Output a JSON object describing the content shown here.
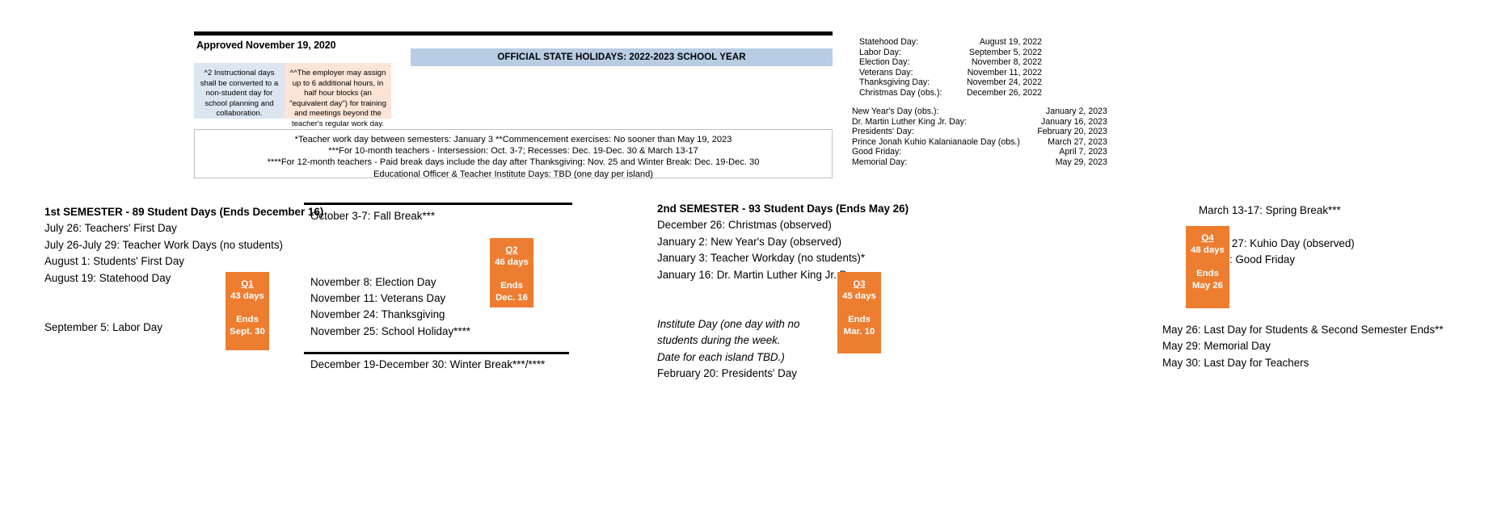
{
  "header": {
    "approved_text": "Approved November 19, 2020",
    "banner_title": "OFFICIAL STATE HOLIDAYS:  2022-2023 SCHOOL YEAR",
    "banner_color": "#b8cce4"
  },
  "notes": {
    "instructional_days": "^2 Instructional days shall be converted to a non-student day for school planning and collaboration.",
    "instructional_days_color": "#dce6f1",
    "employer_hours": "^^The employer may assign up to 6 additional hours, in half hour blocks (an \"equivalent day\") for training and meetings beyond the teacher's regular work day.",
    "employer_hours_color": "#fce4d6"
  },
  "footnotes": [
    "*Teacher work day between semesters: January 3   **Commencement exercises: No sooner than May 19, 2023",
    "***For 10-month teachers - Intersession: Oct. 3-7; Recesses: Dec. 19-Dec. 30 & March 13-17",
    "****For 12-month teachers - Paid break days include the day after Thanksgiving: Nov. 25 and Winter Break: Dec. 19-Dec. 30",
    "Educational Officer & Teacher Institute Days: TBD (one day per island)"
  ],
  "holidays_2022": [
    {
      "name": "Statehood Day:",
      "date": "August 19, 2022"
    },
    {
      "name": "Labor Day:",
      "date": "September 5, 2022"
    },
    {
      "name": "Election Day:",
      "date": "November 8, 2022"
    },
    {
      "name": "Veterans Day:",
      "date": "November 11, 2022"
    },
    {
      "name": "Thanksgiving Day:",
      "date": "November 24, 2022"
    },
    {
      "name": "Christmas Day (obs.):",
      "date": "December 26, 2022"
    }
  ],
  "holidays_2023": [
    {
      "name": "New Year's Day (obs.):",
      "date": "January 2, 2023"
    },
    {
      "name": "Dr. Martin Luther King Jr. Day:",
      "date": "January 16, 2023"
    },
    {
      "name": "Presidents' Day:",
      "date": "February 20, 2023"
    },
    {
      "name": "Prince Jonah Kuhio Kalanianaole Day (obs.)",
      "date": "March 27, 2023"
    },
    {
      "name": "Good Friday:",
      "date": "April 7, 2023"
    },
    {
      "name": "Memorial Day:",
      "date": "May 29, 2023"
    }
  ],
  "semester1": {
    "title": "1st SEMESTER - 89 Student Days (Ends December 16)",
    "lines": [
      "July 26: Teachers' First Day",
      "July 26-July 29: Teacher Work Days (no students)",
      "August 1: Students' First Day",
      "August 19: Statehood Day",
      "",
      "September 5: Labor Day"
    ]
  },
  "fall_column": {
    "lines": [
      "October 3-7: Fall Break***",
      "",
      "",
      "",
      "November 8: Election Day",
      "November 11: Veterans Day",
      "November 24: Thanksgiving",
      "November 25: School Holiday****",
      "",
      "December 19-December 30: Winter Break***/****"
    ]
  },
  "semester2": {
    "title": "2nd SEMESTER - 93 Student Days (Ends May 26)",
    "lines": [
      "December 26: Christmas (observed)",
      "January 2: New Year's Day (observed)",
      "January 3: Teacher Workday (no students)*",
      "January 16: Dr. Martin Luther King Jr. Day"
    ],
    "institute_lines": [
      "Institute Day (one day with no",
      "students during the week.",
      "Date for each island TBD.)"
    ],
    "presidents_day": "February 20: Presidents' Day"
  },
  "spring_column": {
    "lines": [
      "March 13-17: Spring Break***",
      "",
      "March 27: Kuhio Day (observed)",
      "April 7: Good Friday"
    ]
  },
  "may_column": {
    "lines": [
      "May 26: Last Day for Students & Second Semester Ends**",
      "May 29: Memorial Day",
      "May 30:  Last Day for Teachers"
    ]
  },
  "quarters": {
    "badge_color": "#ed7d31",
    "q1": {
      "label": "Q1",
      "days": "43 days",
      "ends": "Ends",
      "end_date": "Sept. 30"
    },
    "q2": {
      "label": "Q2",
      "days": "46 days",
      "ends": "Ends",
      "end_date": "Dec. 16"
    },
    "q3": {
      "label": "Q3",
      "days": "45 days",
      "ends": "Ends",
      "end_date": "Mar. 10"
    },
    "q4": {
      "label": "Q4",
      "days": "48 days",
      "ends": "Ends",
      "end_date": "May 26"
    }
  }
}
